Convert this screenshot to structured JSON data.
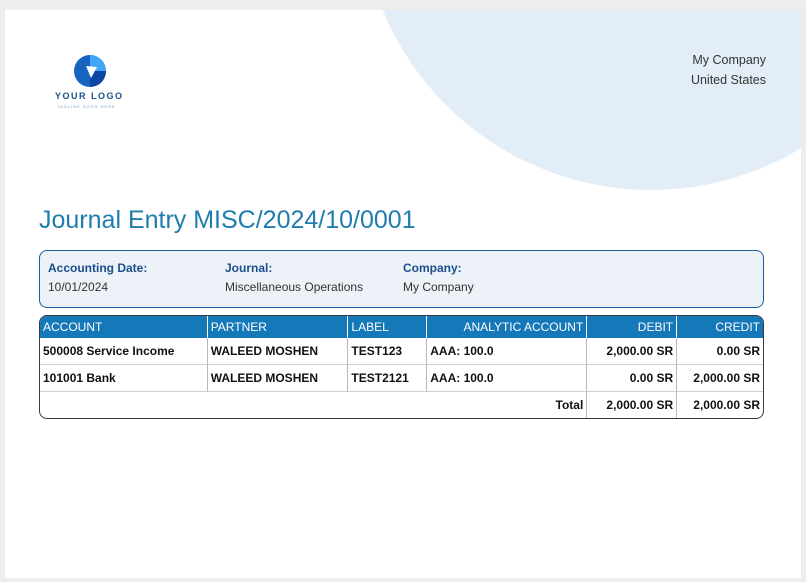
{
  "logo": {
    "text": "YOUR LOGO",
    "tagline": "TAGLINE GOES HERE"
  },
  "company": {
    "name": "My Company",
    "country": "United States"
  },
  "title": "Journal Entry MISC/2024/10/0001",
  "info": {
    "accounting_date": {
      "label": "Accounting Date:",
      "value": "10/01/2024"
    },
    "journal": {
      "label": "Journal:",
      "value": "Miscellaneous Operations"
    },
    "company": {
      "label": "Company:",
      "value": "My Company"
    }
  },
  "table": {
    "headers": [
      "ACCOUNT",
      "PARTNER",
      "LABEL",
      "ANALYTIC ACCOUNT",
      "DEBIT",
      "CREDIT"
    ],
    "rows": [
      {
        "account": "500008 Service Income",
        "partner": "WALEED MOSHEN",
        "label": "TEST123",
        "analytic": "AAA: 100.0",
        "debit": "2,000.00 SR",
        "credit": "0.00 SR"
      },
      {
        "account": "101001 Bank",
        "partner": "WALEED MOSHEN",
        "label": "TEST2121",
        "analytic": "AAA: 100.0",
        "debit": "0.00 SR",
        "credit": "2,000.00 SR"
      }
    ],
    "total": {
      "label": "Total",
      "debit": "2,000.00 SR",
      "credit": "2,000.00 SR"
    }
  },
  "colors": {
    "accent": "#1578b8",
    "title": "#1f7dae",
    "decor": "#e3edf7",
    "box_border": "#1b5d9a"
  }
}
